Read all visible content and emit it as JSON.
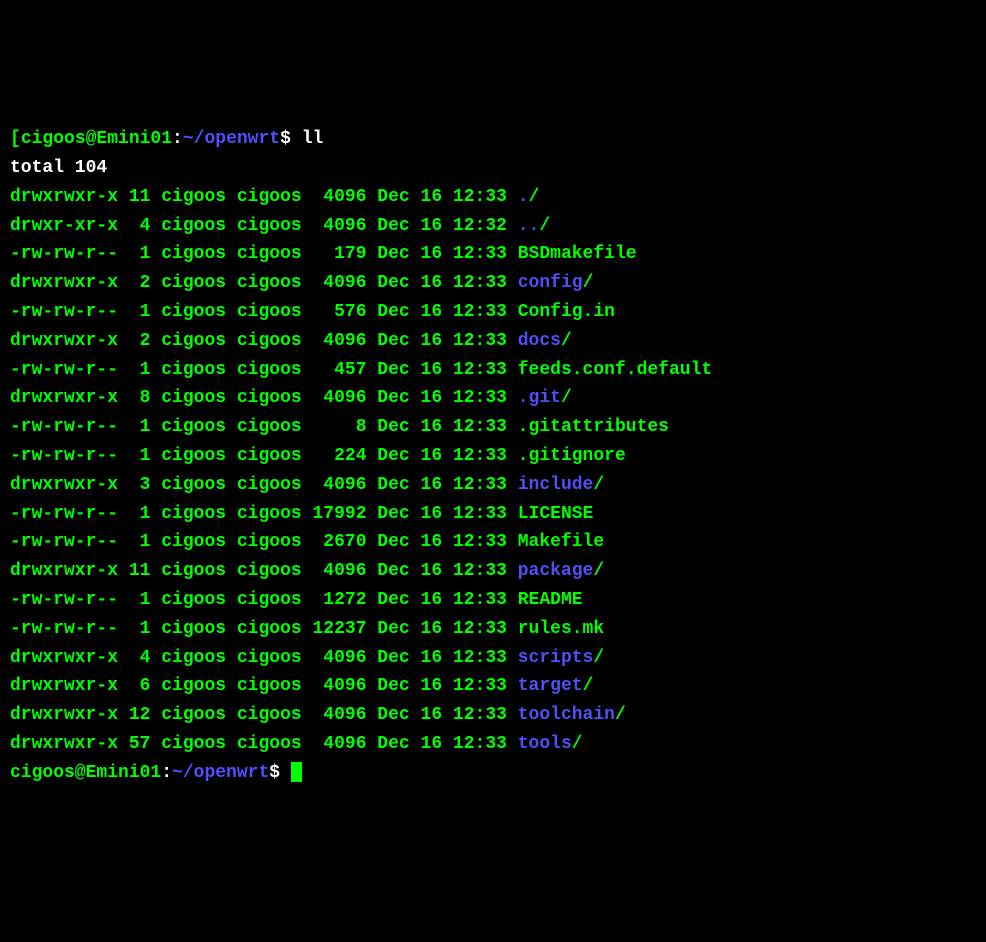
{
  "prompt1": {
    "bracket_open": "[",
    "user_host": "cigoos@Emini01",
    "sep": ":",
    "path": "~/openwrt",
    "dollar": "$ ",
    "command": "ll"
  },
  "total_line": "total 104",
  "rows": [
    {
      "perm": "drwxrwxr-x",
      "links": "11",
      "owner": "cigoos",
      "group": "cigoos",
      "size": "4096",
      "month": "Dec",
      "day": "16",
      "time": "12:33",
      "name": ".",
      "suffix": "/",
      "name_color": "blue",
      "suffix_color": "green"
    },
    {
      "perm": "drwxr-xr-x",
      "links": "4",
      "owner": "cigoos",
      "group": "cigoos",
      "size": "4096",
      "month": "Dec",
      "day": "16",
      "time": "12:32",
      "name": "..",
      "suffix": "/",
      "name_color": "blue",
      "suffix_color": "green"
    },
    {
      "perm": "-rw-rw-r--",
      "links": "1",
      "owner": "cigoos",
      "group": "cigoos",
      "size": "179",
      "month": "Dec",
      "day": "16",
      "time": "12:33",
      "name": "BSDmakefile",
      "suffix": "",
      "name_color": "green",
      "suffix_color": "green"
    },
    {
      "perm": "drwxrwxr-x",
      "links": "2",
      "owner": "cigoos",
      "group": "cigoos",
      "size": "4096",
      "month": "Dec",
      "day": "16",
      "time": "12:33",
      "name": "config",
      "suffix": "/",
      "name_color": "blue",
      "suffix_color": "green"
    },
    {
      "perm": "-rw-rw-r--",
      "links": "1",
      "owner": "cigoos",
      "group": "cigoos",
      "size": "576",
      "month": "Dec",
      "day": "16",
      "time": "12:33",
      "name": "Config.in",
      "suffix": "",
      "name_color": "green",
      "suffix_color": "green"
    },
    {
      "perm": "drwxrwxr-x",
      "links": "2",
      "owner": "cigoos",
      "group": "cigoos",
      "size": "4096",
      "month": "Dec",
      "day": "16",
      "time": "12:33",
      "name": "docs",
      "suffix": "/",
      "name_color": "blue",
      "suffix_color": "green"
    },
    {
      "perm": "-rw-rw-r--",
      "links": "1",
      "owner": "cigoos",
      "group": "cigoos",
      "size": "457",
      "month": "Dec",
      "day": "16",
      "time": "12:33",
      "name": "feeds.conf.default",
      "suffix": "",
      "name_color": "green",
      "suffix_color": "green"
    },
    {
      "perm": "drwxrwxr-x",
      "links": "8",
      "owner": "cigoos",
      "group": "cigoos",
      "size": "4096",
      "month": "Dec",
      "day": "16",
      "time": "12:33",
      "name": ".git",
      "suffix": "/",
      "name_color": "blue",
      "suffix_color": "green"
    },
    {
      "perm": "-rw-rw-r--",
      "links": "1",
      "owner": "cigoos",
      "group": "cigoos",
      "size": "8",
      "month": "Dec",
      "day": "16",
      "time": "12:33",
      "name": ".gitattributes",
      "suffix": "",
      "name_color": "green",
      "suffix_color": "green"
    },
    {
      "perm": "-rw-rw-r--",
      "links": "1",
      "owner": "cigoos",
      "group": "cigoos",
      "size": "224",
      "month": "Dec",
      "day": "16",
      "time": "12:33",
      "name": ".gitignore",
      "suffix": "",
      "name_color": "green",
      "suffix_color": "green"
    },
    {
      "perm": "drwxrwxr-x",
      "links": "3",
      "owner": "cigoos",
      "group": "cigoos",
      "size": "4096",
      "month": "Dec",
      "day": "16",
      "time": "12:33",
      "name": "include",
      "suffix": "/",
      "name_color": "blue",
      "suffix_color": "green"
    },
    {
      "perm": "-rw-rw-r--",
      "links": "1",
      "owner": "cigoos",
      "group": "cigoos",
      "size": "17992",
      "month": "Dec",
      "day": "16",
      "time": "12:33",
      "name": "LICENSE",
      "suffix": "",
      "name_color": "green",
      "suffix_color": "green"
    },
    {
      "perm": "-rw-rw-r--",
      "links": "1",
      "owner": "cigoos",
      "group": "cigoos",
      "size": "2670",
      "month": "Dec",
      "day": "16",
      "time": "12:33",
      "name": "Makefile",
      "suffix": "",
      "name_color": "green",
      "suffix_color": "green"
    },
    {
      "perm": "drwxrwxr-x",
      "links": "11",
      "owner": "cigoos",
      "group": "cigoos",
      "size": "4096",
      "month": "Dec",
      "day": "16",
      "time": "12:33",
      "name": "package",
      "suffix": "/",
      "name_color": "blue",
      "suffix_color": "green"
    },
    {
      "perm": "-rw-rw-r--",
      "links": "1",
      "owner": "cigoos",
      "group": "cigoos",
      "size": "1272",
      "month": "Dec",
      "day": "16",
      "time": "12:33",
      "name": "README",
      "suffix": "",
      "name_color": "green",
      "suffix_color": "green"
    },
    {
      "perm": "-rw-rw-r--",
      "links": "1",
      "owner": "cigoos",
      "group": "cigoos",
      "size": "12237",
      "month": "Dec",
      "day": "16",
      "time": "12:33",
      "name": "rules.mk",
      "suffix": "",
      "name_color": "green",
      "suffix_color": "green"
    },
    {
      "perm": "drwxrwxr-x",
      "links": "4",
      "owner": "cigoos",
      "group": "cigoos",
      "size": "4096",
      "month": "Dec",
      "day": "16",
      "time": "12:33",
      "name": "scripts",
      "suffix": "/",
      "name_color": "blue",
      "suffix_color": "green"
    },
    {
      "perm": "drwxrwxr-x",
      "links": "6",
      "owner": "cigoos",
      "group": "cigoos",
      "size": "4096",
      "month": "Dec",
      "day": "16",
      "time": "12:33",
      "name": "target",
      "suffix": "/",
      "name_color": "blue",
      "suffix_color": "green"
    },
    {
      "perm": "drwxrwxr-x",
      "links": "12",
      "owner": "cigoos",
      "group": "cigoos",
      "size": "4096",
      "month": "Dec",
      "day": "16",
      "time": "12:33",
      "name": "toolchain",
      "suffix": "/",
      "name_color": "blue",
      "suffix_color": "green"
    },
    {
      "perm": "drwxrwxr-x",
      "links": "57",
      "owner": "cigoos",
      "group": "cigoos",
      "size": "4096",
      "month": "Dec",
      "day": "16",
      "time": "12:33",
      "name": "tools",
      "suffix": "/",
      "name_color": "blue",
      "suffix_color": "green"
    }
  ],
  "prompt2": {
    "user_host": "cigoos@Emini01",
    "sep": ":",
    "path": "~/openwrt",
    "dollar": "$ "
  }
}
